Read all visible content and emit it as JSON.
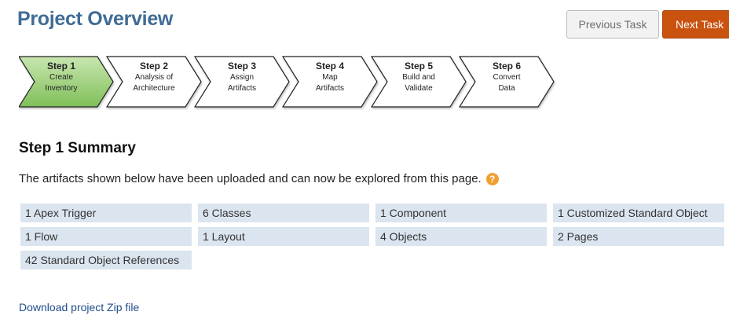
{
  "header": {
    "title": "Project Overview",
    "previous_label": "Previous Task",
    "next_label": "Next Task"
  },
  "steps": [
    {
      "number": "Step 1",
      "line1": "Create",
      "line2": "Inventory",
      "active": true
    },
    {
      "number": "Step 2",
      "line1": "Analysis of",
      "line2": "Architecture",
      "active": false
    },
    {
      "number": "Step 3",
      "line1": "Assign",
      "line2": "Artifacts",
      "active": false
    },
    {
      "number": "Step 4",
      "line1": "Map",
      "line2": "Artifacts",
      "active": false
    },
    {
      "number": "Step 5",
      "line1": "Build and",
      "line2": "Validate",
      "active": false
    },
    {
      "number": "Step 6",
      "line1": "Convert",
      "line2": "Data",
      "active": false
    }
  ],
  "colors": {
    "active_step_fill": "#8fc96a",
    "inactive_step_fill": "#ffffff",
    "next_button": "#c9520f",
    "title": "#3f6c96",
    "artifact_bg": "#dbe5ef"
  },
  "summary": {
    "title": "Step 1 Summary",
    "intro": "The artifacts shown below have been uploaded and can now be explored from this page.",
    "help_icon": "?"
  },
  "artifacts": [
    "1 Apex Trigger",
    "6 Classes",
    "1 Component",
    "1 Customized Standard Object",
    "1 Flow",
    "1 Layout",
    "4 Objects",
    "2 Pages",
    "42 Standard Object References"
  ],
  "footer": {
    "download_label": "Download project Zip file"
  }
}
